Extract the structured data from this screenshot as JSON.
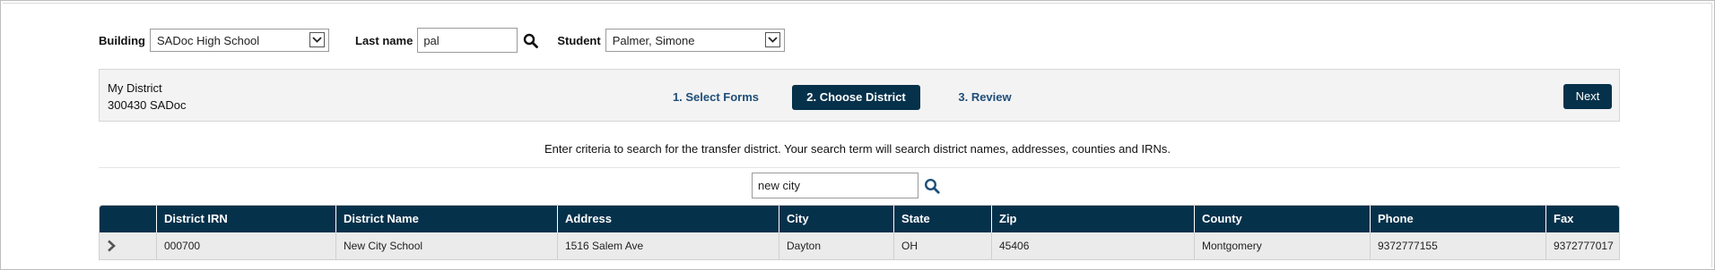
{
  "filters": {
    "building_label": "Building",
    "building_value": "SADoc High School",
    "lastname_label": "Last name",
    "lastname_value": "pal",
    "student_label": "Student",
    "student_value": "Palmer, Simone"
  },
  "wizard": {
    "district_name": "My District",
    "district_code": "300430 SADoc",
    "steps": [
      {
        "label": "1. Select Forms",
        "active": false
      },
      {
        "label": "2. Choose District",
        "active": true
      },
      {
        "label": "3. Review",
        "active": false
      }
    ],
    "next_label": "Next"
  },
  "search": {
    "instructions": "Enter criteria to search for the transfer district. Your search term will search district names, addresses, counties and IRNs.",
    "value": "new city"
  },
  "table": {
    "columns": [
      "",
      "District IRN",
      "District Name",
      "Address",
      "City",
      "State",
      "Zip",
      "County",
      "Phone",
      "Fax"
    ],
    "rows": [
      [
        "",
        "000700",
        "New City School",
        "1516 Salem Ave",
        "Dayton",
        "OH",
        "45406",
        "Montgomery",
        "9372777155",
        "9372777017"
      ]
    ]
  },
  "colors": {
    "primary_dark": "#06314b",
    "step_link": "#1f4e79",
    "panel_bg": "#f3f3f3",
    "row_bg": "#ebebeb"
  },
  "icons": {
    "search": "search-icon",
    "dropdown": "chevron-down-icon",
    "expand": "chevron-right-icon"
  }
}
